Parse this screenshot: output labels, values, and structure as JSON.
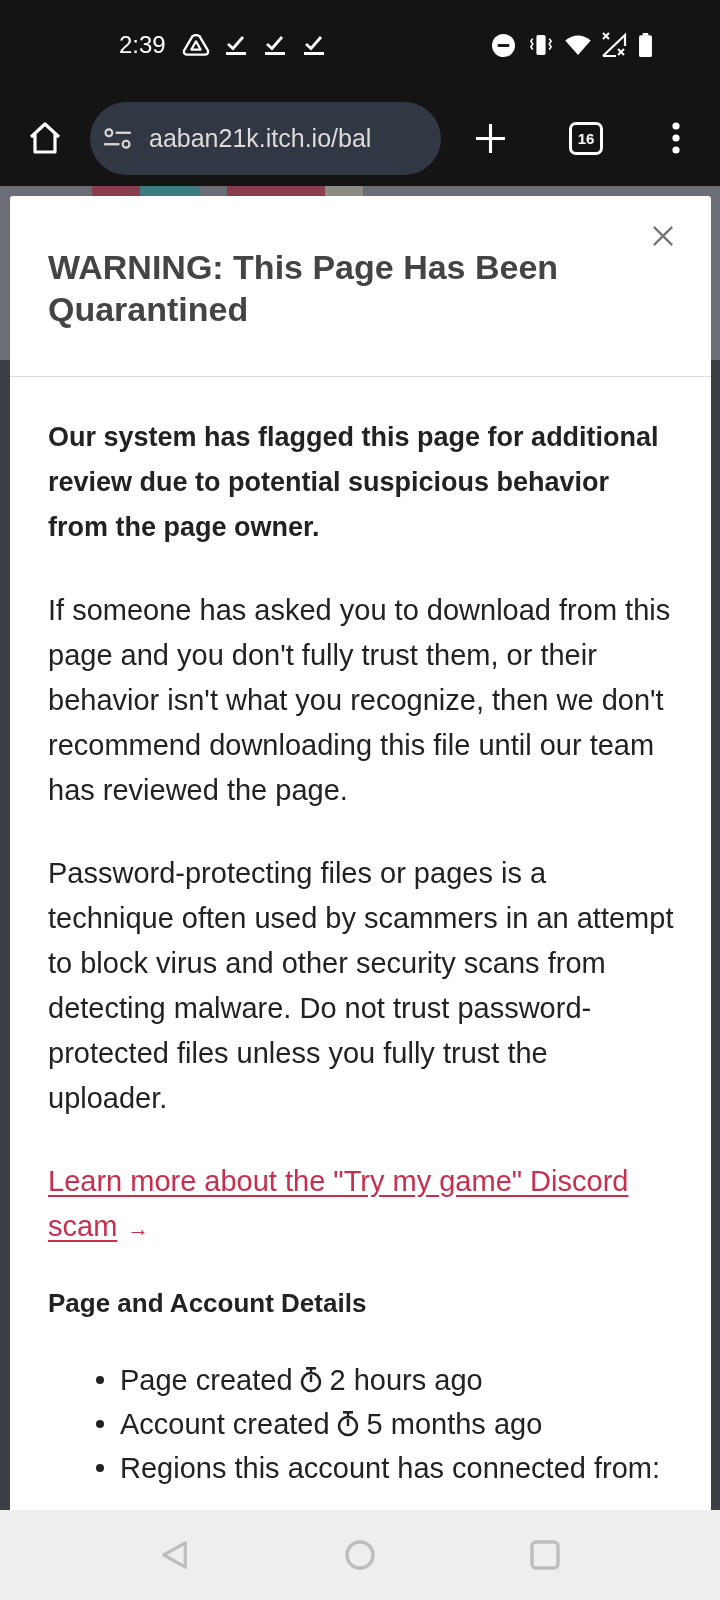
{
  "status_bar": {
    "time": "2:39"
  },
  "browser_toolbar": {
    "url": "aaban21k.itch.io/bal",
    "tab_count": "16"
  },
  "dialog": {
    "title": "WARNING: This Page Has Been Quarantined",
    "intro": "Our system has flagged this page for additional review due to potential suspicious behavior from the page owner.",
    "paragraphs": [
      "If someone has asked you to download from this page and you don't fully trust them, or their behavior isn't what you recognize, then we don't recommend downloading this file until our team has reviewed the page.",
      "Password-protecting files or pages is a technique often used by scammers in an attempt to block virus and other security scans from detecting malware. Do not trust password-protected files unless you fully trust the uploader."
    ],
    "link": {
      "text": "Learn more about the \"Try my game\" Discord scam",
      "arrow": "→"
    },
    "details_heading": "Page and Account Details",
    "details": [
      {
        "kind": "timestamp",
        "label": "Page created",
        "value": "2 hours ago"
      },
      {
        "kind": "timestamp",
        "label": "Account created",
        "value": "5 months ago"
      },
      {
        "kind": "text",
        "label": "Regions this account has connected from:"
      }
    ]
  }
}
